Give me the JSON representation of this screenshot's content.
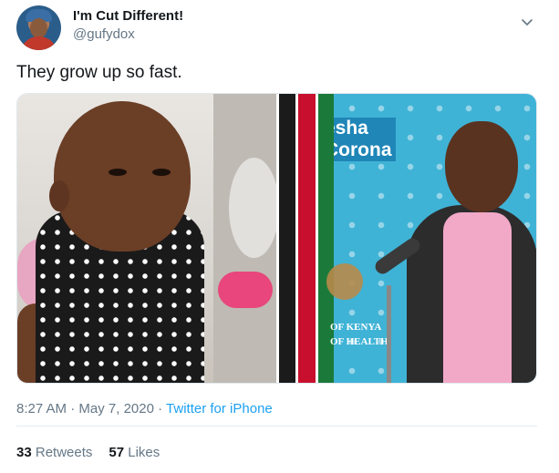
{
  "tweet": {
    "display_name": "I'm Cut Different!",
    "handle": "@gufydox",
    "text": "They grow up so fast.",
    "time": "8:27 AM",
    "date": "May 7, 2020",
    "separator": "·",
    "source": "Twitter for iPhone",
    "retweets_count": "33",
    "retweets_label": "Retweets",
    "likes_count": "57",
    "likes_label": "Likes"
  },
  "media": {
    "right_banner": "esha\nCorona",
    "ministry_text": "OF KENYA\nOF HEALTH"
  },
  "icons": {
    "more": "chevron-down-icon"
  },
  "colors": {
    "link": "#1da1f2",
    "muted": "#657786",
    "text": "#14171a"
  }
}
